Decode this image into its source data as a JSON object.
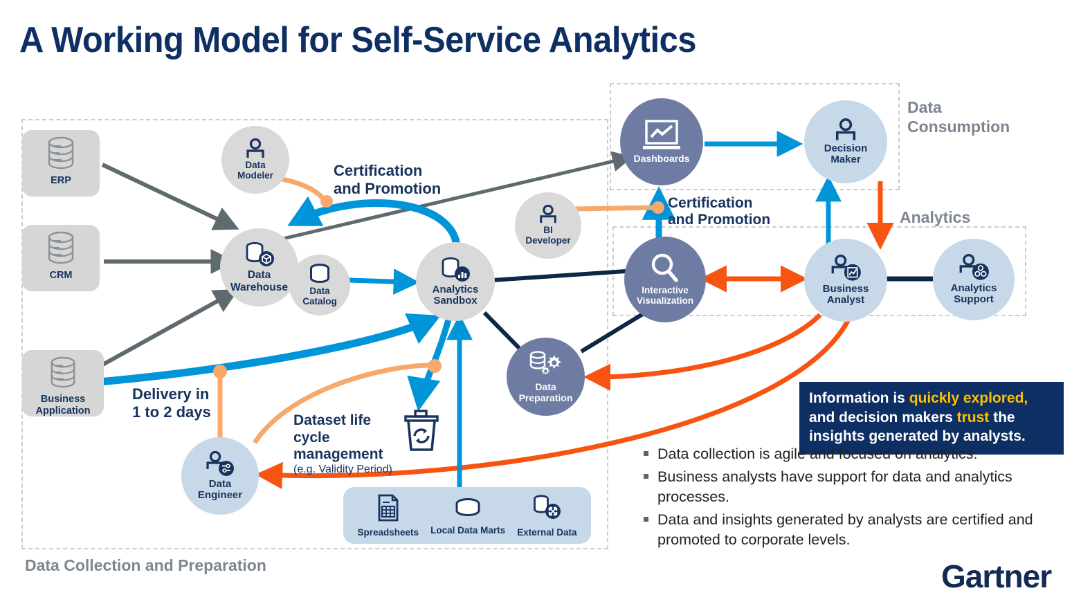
{
  "title": "A Working Model for Self-Service Analytics",
  "brand": {
    "logo_text": "Gartner"
  },
  "colors": {
    "navy": "#17335e",
    "title_navy": "#0e2f63",
    "blue": "#0095d9",
    "orange": "#f7941e",
    "peach": "#f6a96b",
    "red_orange": "#f75311",
    "grey_arrow": "#5f6a6f",
    "dark_navy_line": "#0e2747",
    "slate": "#6e7ba3",
    "light_blue": "#c7d9e8",
    "grey_node": "#d9d9d9",
    "grey_box": "#d6d6d6",
    "zone_border": "#c9cdd2",
    "zone_label": "#7d8691",
    "callout_bg": "#0e2f63",
    "callout_highlight": "#ffc000"
  },
  "zones": [
    {
      "id": "collection",
      "label": "Data Collection and Preparation"
    },
    {
      "id": "consumption",
      "label": "Data\nConsumption"
    },
    {
      "id": "analytics",
      "label": "Analytics"
    }
  ],
  "sources": [
    {
      "id": "erp",
      "label": "ERP",
      "icon": "database-icon"
    },
    {
      "id": "crm",
      "label": "CRM",
      "icon": "database-icon"
    },
    {
      "id": "business_application",
      "label": "Business\nApplication",
      "icon": "database-icon"
    }
  ],
  "nodes": [
    {
      "id": "data_modeler",
      "label": "Data\nModeler",
      "icon": "person-icon",
      "style": "grey"
    },
    {
      "id": "data_warehouse",
      "label": "Data\nWarehouse",
      "icon": "database-box-icon",
      "style": "grey"
    },
    {
      "id": "data_catalog",
      "label": "Data\nCatalog",
      "icon": "catalog-cylinder-icon",
      "style": "grey"
    },
    {
      "id": "analytics_sandbox",
      "label": "Analytics\nSandbox",
      "icon": "database-chart-icon",
      "style": "grey"
    },
    {
      "id": "bi_developer",
      "label": "BI\nDeveloper",
      "icon": "person-icon",
      "style": "grey"
    },
    {
      "id": "data_engineer",
      "label": "Data\nEngineer",
      "icon": "person-settings-icon",
      "style": "light-blue"
    },
    {
      "id": "data_preparation",
      "label": "Data\nPreparation",
      "icon": "database-gears-icon",
      "style": "slate"
    },
    {
      "id": "dashboards",
      "label": "Dashboards",
      "icon": "laptop-chart-icon",
      "style": "slate"
    },
    {
      "id": "interactive_visualization",
      "label": "Interactive\nVisualization",
      "icon": "magnifier-icon",
      "style": "slate"
    },
    {
      "id": "decision_maker",
      "label": "Decision\nMaker",
      "icon": "person-icon",
      "style": "light-blue"
    },
    {
      "id": "business_analyst",
      "label": "Business\nAnalyst",
      "icon": "person-chart-icon",
      "style": "light-blue"
    },
    {
      "id": "analytics_support",
      "label": "Analytics\nSupport",
      "icon": "person-gears-icon",
      "style": "light-blue"
    }
  ],
  "bottom_sources": {
    "items": [
      {
        "id": "spreadsheets",
        "label": "Spreadsheets",
        "icon": "spreadsheet-icon"
      },
      {
        "id": "local_data_marts",
        "label": "Local Data Marts",
        "icon": "cylinder-icon"
      },
      {
        "id": "external_data",
        "label": "External Data",
        "icon": "external-data-icon"
      }
    ]
  },
  "flow_labels": {
    "certification_left": "Certification\nand Promotion",
    "certification_right": "Certification\nand Promotion",
    "delivery": "Delivery in\n1 to 2 days",
    "lifecycle_main": "Dataset life cycle\nmanagement",
    "lifecycle_sub": "(e.g. Validity Period)"
  },
  "lifecycle_icon": "recycle-trash-icon",
  "callout": {
    "part1": "Information is ",
    "highlight1": "quickly explored,",
    "part2": " and decision makers ",
    "highlight2": "trust",
    "part3": " the insights generated by analysts."
  },
  "bullets": [
    "Data collection is agile and focused on analytics.",
    "Business analysts have support for data and analytics processes.",
    "Data and insights generated by analysts are certified and promoted to corporate levels."
  ]
}
